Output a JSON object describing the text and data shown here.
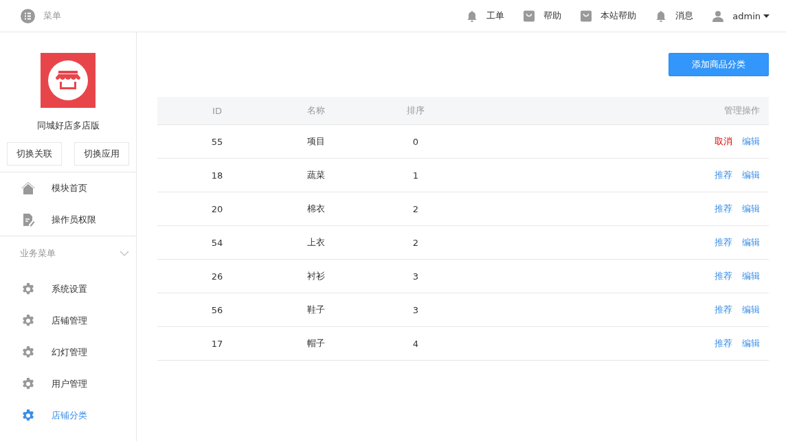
{
  "header": {
    "menu_label": "菜单",
    "nav": [
      {
        "kind": "bell",
        "label": "工单"
      },
      {
        "kind": "bag",
        "label": "帮助"
      },
      {
        "kind": "bag",
        "label": "本站帮助"
      },
      {
        "kind": "bell",
        "label": "消息"
      },
      {
        "kind": "user",
        "label": "admin"
      }
    ]
  },
  "sidebar": {
    "app_name": "同城好店多店版",
    "buttons": [
      "切换关联",
      "切换应用"
    ],
    "top_items": [
      {
        "kind": "home",
        "label": "模块首页",
        "selected": false
      },
      {
        "kind": "doc",
        "label": "操作员权限",
        "selected": false
      }
    ],
    "group": {
      "label": "业务菜单",
      "expanded": true,
      "items": [
        {
          "kind": "gear",
          "label": "系统设置",
          "selected": false
        },
        {
          "kind": "gear",
          "label": "店铺管理",
          "selected": false
        },
        {
          "kind": "gear",
          "label": "幻灯管理",
          "selected": false
        },
        {
          "kind": "gear",
          "label": "用户管理",
          "selected": false
        },
        {
          "kind": "gear",
          "label": "店铺分类",
          "selected": true
        }
      ]
    }
  },
  "main": {
    "add_button": "添加商品分类",
    "table": {
      "columns": [
        "ID",
        "名称",
        "排序",
        "管理操作"
      ],
      "rows": [
        {
          "id": "55",
          "name": "项目",
          "order": "0",
          "actions": [
            {
              "kind": "cancel",
              "label": "取消"
            },
            {
              "kind": "edit",
              "label": "编辑"
            }
          ]
        },
        {
          "id": "18",
          "name": "蔬菜",
          "order": "1",
          "actions": [
            {
              "kind": "recommend",
              "label": "推荐"
            },
            {
              "kind": "edit",
              "label": "编辑"
            }
          ]
        },
        {
          "id": "20",
          "name": "棉衣",
          "order": "2",
          "actions": [
            {
              "kind": "recommend",
              "label": "推荐"
            },
            {
              "kind": "edit",
              "label": "编辑"
            }
          ]
        },
        {
          "id": "54",
          "name": "上衣",
          "order": "2",
          "actions": [
            {
              "kind": "recommend",
              "label": "推荐"
            },
            {
              "kind": "edit",
              "label": "编辑"
            }
          ]
        },
        {
          "id": "26",
          "name": "衬衫",
          "order": "3",
          "actions": [
            {
              "kind": "recommend",
              "label": "推荐"
            },
            {
              "kind": "edit",
              "label": "编辑"
            }
          ]
        },
        {
          "id": "56",
          "name": "鞋子",
          "order": "3",
          "actions": [
            {
              "kind": "recommend",
              "label": "推荐"
            },
            {
              "kind": "edit",
              "label": "编辑"
            }
          ]
        },
        {
          "id": "17",
          "name": "帽子",
          "order": "4",
          "actions": [
            {
              "kind": "recommend",
              "label": "推荐"
            },
            {
              "kind": "edit",
              "label": "编辑"
            }
          ]
        }
      ]
    }
  }
}
